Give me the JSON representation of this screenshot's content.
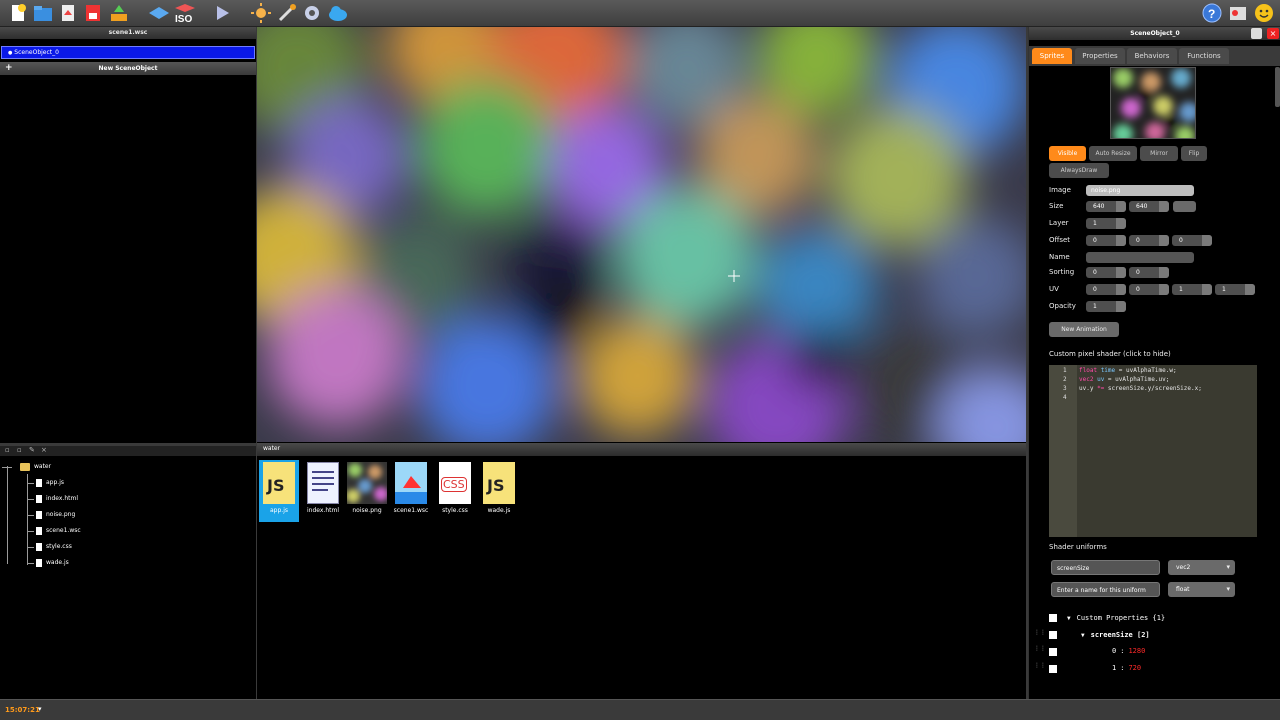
{
  "toolbar": {
    "buttons": [
      "new-file-icon",
      "open-folder-icon",
      "import-icon",
      "save-icon",
      "export-icon",
      "iso-grid-icon",
      "play-icon",
      "sun-icon",
      "tools-icon",
      "settings-icon",
      "cloud-icon"
    ],
    "iso_label": "ISO",
    "right_buttons": [
      "help-icon",
      "fullscreen-icon",
      "smiley-icon"
    ]
  },
  "scene_panel": {
    "title": "scene1.wsc",
    "selected_object": "SceneObject_0",
    "new_object_label": "New SceneObject"
  },
  "file_tree": {
    "root": "water",
    "files": [
      "app.js",
      "index.html",
      "noise.png",
      "scene1.wsc",
      "style.css",
      "wade.js"
    ]
  },
  "assets": {
    "folder": "water",
    "items": [
      {
        "name": "app.js",
        "type": "js",
        "selected": true
      },
      {
        "name": "index.html",
        "type": "html",
        "selected": false
      },
      {
        "name": "noise.png",
        "type": "image",
        "selected": false
      },
      {
        "name": "scene1.wsc",
        "type": "scene",
        "selected": false
      },
      {
        "name": "style.css",
        "type": "css",
        "selected": false
      },
      {
        "name": "wade.js",
        "type": "js",
        "selected": false
      }
    ],
    "js_badge": "JS",
    "css_badge": "CSS"
  },
  "properties": {
    "title": "SceneObject_0",
    "tabs": [
      "Sprites",
      "Properties",
      "Behaviors",
      "Functions"
    ],
    "active_tab": "Sprites",
    "toggles": [
      "Visible",
      "Auto Resize",
      "Mirror",
      "Flip",
      "AlwaysDraw"
    ],
    "labels": {
      "image": "Image",
      "size": "Size",
      "layer": "Layer",
      "offset": "Offset",
      "name": "Name",
      "sorting": "Sorting",
      "uv": "UV",
      "opacity": "Opacity"
    },
    "image": "noise.png",
    "size": [
      "640",
      "640"
    ],
    "layer": "1",
    "offset": [
      "0",
      "0",
      "0"
    ],
    "name": "",
    "sorting": [
      "0",
      "0"
    ],
    "uv": [
      "0",
      "0",
      "1",
      "1"
    ],
    "opacity": "1",
    "new_animation": "New Animation",
    "shader_label": "Custom pixel shader (click to hide)",
    "shader_lines": [
      {
        "n": "1",
        "code": "float time = uvAlphaTime.w;"
      },
      {
        "n": "2",
        "code": "vec2 uv = uvAlphaTime.uv;"
      },
      {
        "n": "3",
        "code": "uv.y *= screenSize.y/screenSize.x;"
      },
      {
        "n": "4",
        "code": ""
      }
    ],
    "uniforms_label": "Shader uniforms",
    "uniform_name": "screenSize",
    "uniform_type": "vec2",
    "uniform_placeholder": "Enter a name for this uniform",
    "uniform_new_type": "float",
    "custom_props": "Custom Properties {1}",
    "screen_size": "screenSize [2]",
    "cp_rows": [
      {
        "index": "0",
        "value": "1280"
      },
      {
        "index": "1",
        "value": "720"
      }
    ],
    "colors": {
      "accent": "#ff8a1a",
      "value_red": "#ff2a2a"
    }
  },
  "status": {
    "clock": "15:07:21"
  }
}
